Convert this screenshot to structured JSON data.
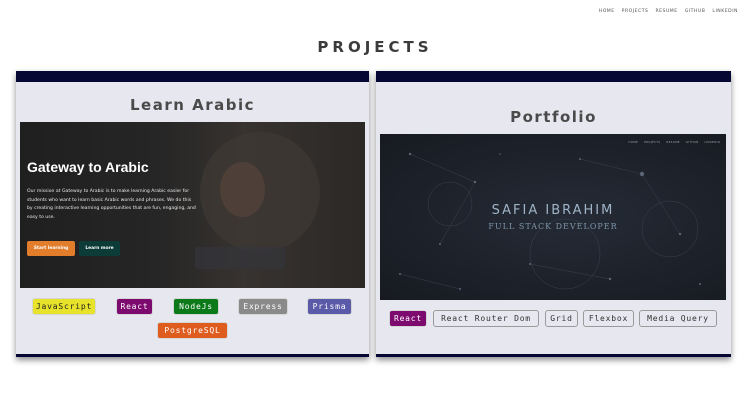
{
  "nav": {
    "items": [
      "HOME",
      "PROJECTS",
      "RESUME",
      "GITHUB",
      "LINKEDIN"
    ]
  },
  "page_title": "PROJECTS",
  "projects": [
    {
      "title": "Learn Arabic",
      "preview": {
        "heading": "Gateway to Arabic",
        "description": "Our mission at Gateway to Arabic is to make learning Arabic easier for students who want to learn basic Arabic words and phrases. We do this by creating interactive learning opportunities that are fun, engaging, and easy to use.",
        "primary_button": "Start learning",
        "secondary_button": "Learn more"
      },
      "tags": [
        "JavaScript",
        "React",
        "NodeJs",
        "Express",
        "Prisma",
        "PostgreSQL"
      ]
    },
    {
      "title": "Portfolio",
      "preview": {
        "nav": [
          "HOME",
          "PROJECTS",
          "RESUME",
          "GITHUB",
          "LINKEDIN"
        ],
        "name": "SAFIA IBRAHIM",
        "subtitle": "FULL STACK DEVELOPER"
      },
      "tags": [
        "React",
        "React Router Dom",
        "Grid",
        "Flexbox",
        "Media Query"
      ]
    }
  ],
  "colors": {
    "card_bar": "#070733",
    "card_bg": "#e7e7ef",
    "javascript": "#e7e22a",
    "react": "#7d0a6f",
    "nodejs": "#0d7a1a",
    "express": "#8a8a8a",
    "prisma": "#5b5aa8",
    "postgresql": "#df5c1f",
    "start_button": "#e17d2b",
    "learn_button": "#0d3b38"
  }
}
